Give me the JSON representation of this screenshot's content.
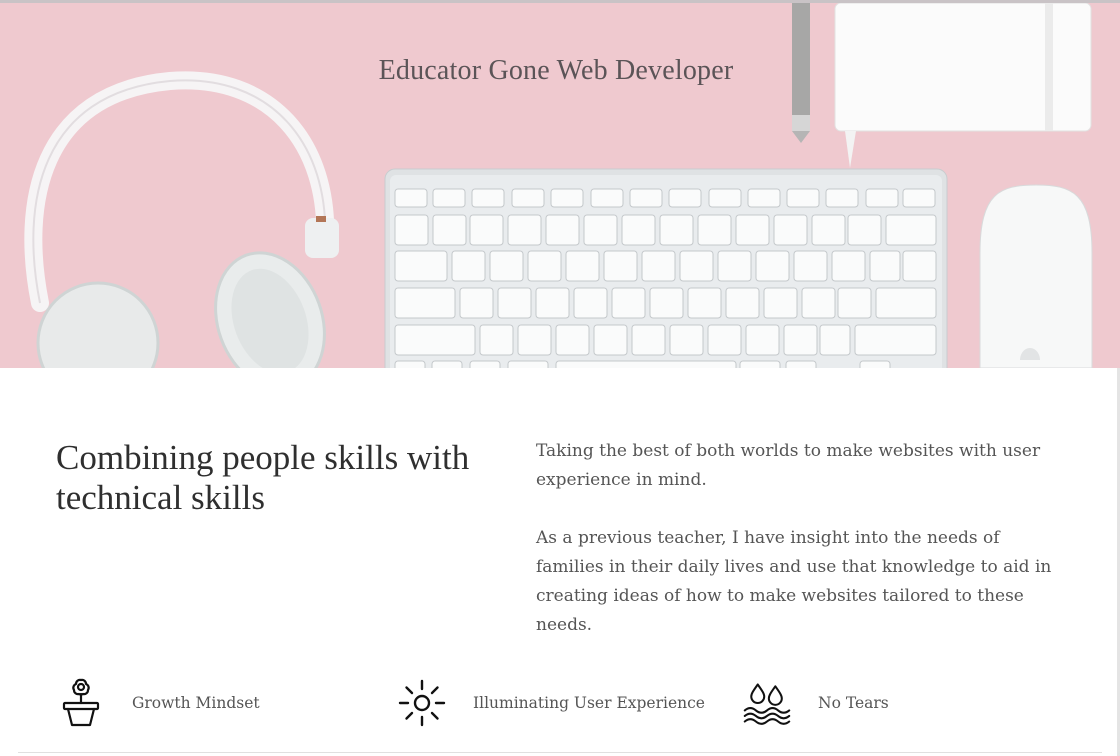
{
  "hero": {
    "title": "Educator Gone Web Developer",
    "image": "pink desk with headphones, keyboard, pencil, notebook and mouse",
    "background_color": "#efc9cf"
  },
  "intro": {
    "heading": "Combining people skills with technical skills",
    "paragraph_1": "Taking the best of both worlds to make websites with user experience in mind.",
    "paragraph_2": "As a previous teacher, I have insight into the needs of families in their daily lives and use that knowledge to aid in creating ideas of how to make websites tailored to these needs."
  },
  "features": [
    {
      "icon": "flower-pot-icon",
      "label": "Growth Mindset"
    },
    {
      "icon": "sun-icon",
      "label": "Illuminating User Experience"
    },
    {
      "icon": "water-drops-icon",
      "label": "No Tears"
    }
  ]
}
